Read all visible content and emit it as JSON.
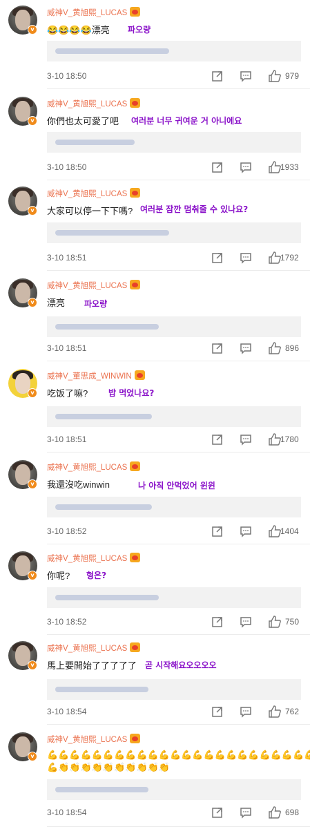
{
  "comments": [
    {
      "name": "威神V_黄旭熙_LUCAS",
      "text": "😂😂😂😂漂亮",
      "translation": "파오량",
      "time": "3-10 18:50",
      "likes": "979",
      "avatar": "lucas"
    },
    {
      "name": "威神V_黄旭熙_LUCAS",
      "text": "你們也太可愛了吧",
      "translation": "여러분 너무 귀여운 거 아니에요",
      "time": "3-10 18:50",
      "likes": "1933",
      "avatar": "lucas"
    },
    {
      "name": "威神V_黄旭熙_LUCAS",
      "text": "大家可以停一下下嗎?",
      "translation": "여러분 잠깐 멈춰줄 수 있나요?",
      "time": "3-10 18:51",
      "likes": "1792",
      "avatar": "lucas"
    },
    {
      "name": "威神V_黄旭熙_LUCAS",
      "text": "漂亮",
      "translation": "파오량",
      "time": "3-10 18:51",
      "likes": "896",
      "avatar": "lucas"
    },
    {
      "name": "威神V_董思成_WINWIN",
      "text": "吃饭了嘛?",
      "translation": "밥 먹었나요?",
      "time": "3-10 18:51",
      "likes": "1780",
      "avatar": "winwin"
    },
    {
      "name": "威神V_黄旭熙_LUCAS",
      "text": "我還沒吃winwin",
      "translation": "나 아직 안먹었어 윈윈",
      "time": "3-10 18:52",
      "likes": "1404",
      "avatar": "lucas"
    },
    {
      "name": "威神V_黄旭熙_LUCAS",
      "text": "你呢?",
      "translation": "형은?",
      "time": "3-10 18:52",
      "likes": "750",
      "avatar": "lucas"
    },
    {
      "name": "威神V_黄旭熙_LUCAS",
      "text": "馬上要開始了了了了了",
      "translation": "곧 시작해요오오오오",
      "time": "3-10 18:54",
      "likes": "762",
      "avatar": "lucas"
    },
    {
      "name": "威神V_黄旭熙_LUCAS",
      "text": "💪💪💪💪💪💪💪💪💪💪💪💪💪💪💪💪💪💪💪💪💪💪💪💪",
      "text2": "💪👏👏👏👏👏👏👏👏👏👏",
      "translation": "",
      "time": "3-10 18:54",
      "likes": "698",
      "avatar": "lucas"
    }
  ],
  "icons": {
    "share": "share-icon",
    "comment": "comment-icon",
    "like": "thumbs-up-icon",
    "verified": "verified-badge-icon",
    "vip": "vip-crown-icon"
  },
  "colors": {
    "username": "#eb7350",
    "translation": "#8a12c9",
    "verified": "#f08b1b",
    "replybox": "#f2f2f2"
  }
}
